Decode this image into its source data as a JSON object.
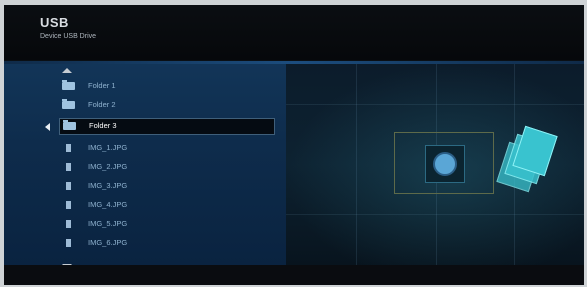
{
  "header": {
    "title": "USB",
    "subtitle": "Device USB Drive"
  },
  "list": {
    "items": [
      {
        "label": "Folder 1",
        "type": "folder"
      },
      {
        "label": "Folder 2",
        "type": "folder"
      },
      {
        "label": "Folder 3",
        "type": "folder"
      },
      {
        "label": "IMG_1.JPG",
        "type": "file"
      },
      {
        "label": "IMG_2.JPG",
        "type": "file"
      },
      {
        "label": "IMG_3.JPG",
        "type": "file"
      },
      {
        "label": "IMG_4.JPG",
        "type": "file"
      },
      {
        "label": "IMG_5.JPG",
        "type": "file"
      },
      {
        "label": "IMG_6.JPG",
        "type": "file"
      }
    ],
    "selected_label": "Folder 3"
  },
  "icons": {
    "scroll_up": "chevron-up-icon",
    "scroll_down": "chevron-down-icon",
    "folder": "folder-icon",
    "file": "image-file-icon",
    "preview": "photo-stack-icon"
  },
  "colors": {
    "list_background": "#123558",
    "selected_row": "#050b12",
    "accent": "#39c3cf"
  }
}
